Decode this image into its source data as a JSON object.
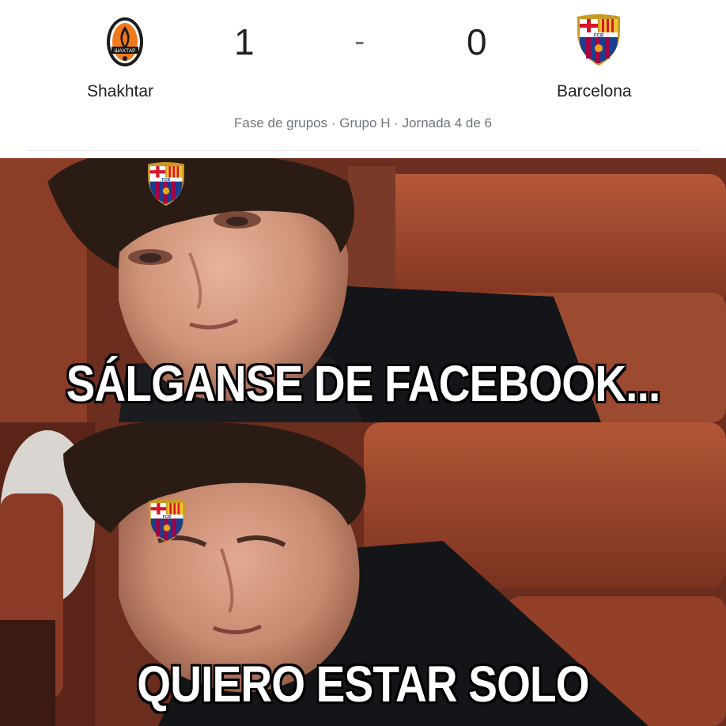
{
  "scoreboard": {
    "home_team": "Shakhtar",
    "away_team": "Barcelona",
    "home_score": "1",
    "away_score": "0",
    "separator": "-",
    "meta": "Fase de grupos · Grupo H · Jornada 4 de 6",
    "home_crest_text": "ШАХТАР",
    "away_crest_text": "FCB"
  },
  "meme": {
    "top_caption": "SÁLGANSE DE FACEBOOK...",
    "bottom_caption": "QUIERO ESTAR SOLO",
    "badge_text": "FCB"
  },
  "colors": {
    "barca_blue": "#1a3f8f",
    "barca_red": "#a50044",
    "barca_yellow": "#f2c12e",
    "shakhtar_orange": "#f07a1a",
    "seat_red": "#a6452a"
  }
}
